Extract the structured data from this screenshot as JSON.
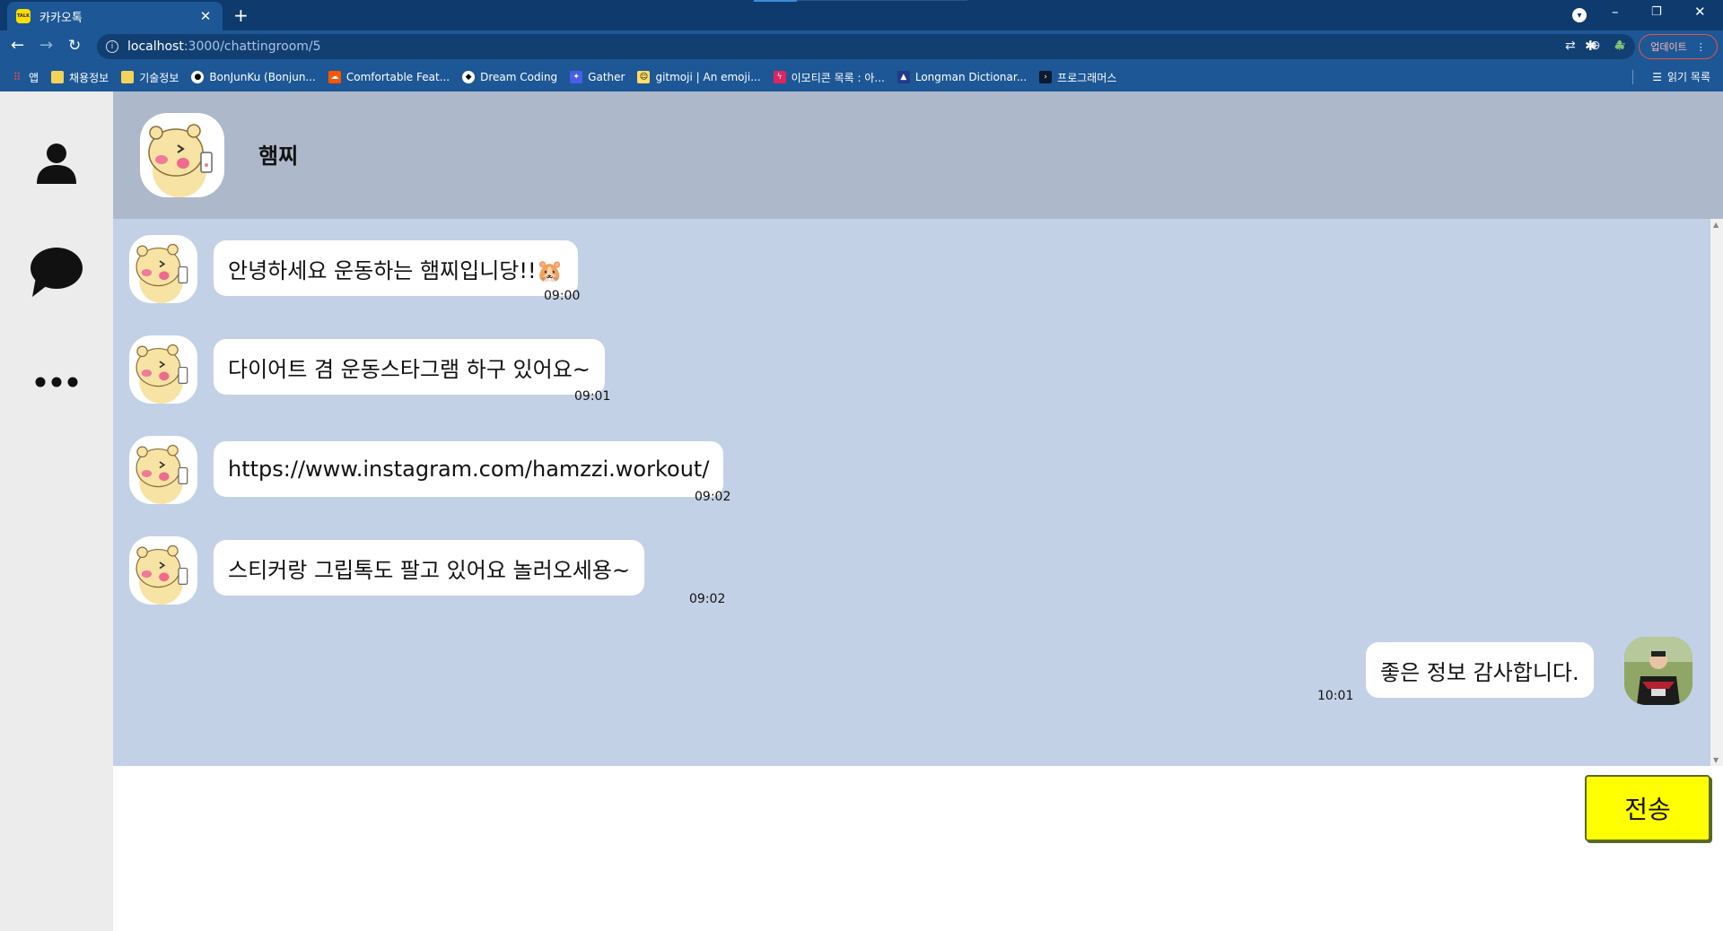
{
  "browser": {
    "tab_title": "카카오톡",
    "tab_favicon": "TALK",
    "url_host": "localhost",
    "url_path": ":3000/chattingroom/5",
    "update_label": "업데이트",
    "bookmarks": [
      {
        "label": "앱",
        "icon": "apps-grid-icon"
      },
      {
        "label": "채용정보",
        "icon": "folder-icon"
      },
      {
        "label": "기술정보",
        "icon": "folder-icon"
      },
      {
        "label": "BonJunKu (Bonjun...",
        "icon": "github-icon"
      },
      {
        "label": "Comfortable Feat...",
        "icon": "soundcloud-icon"
      },
      {
        "label": "Dream Coding",
        "icon": "dream-coding-icon"
      },
      {
        "label": "Gather",
        "icon": "gather-icon"
      },
      {
        "label": "gitmoji | An emoji...",
        "icon": "gitmoji-icon"
      },
      {
        "label": "이모티콘 목록 : 아...",
        "icon": "lightning-icon"
      },
      {
        "label": "Longman Dictionar...",
        "icon": "longman-icon"
      },
      {
        "label": "프로그래머스",
        "icon": "programmers-icon"
      }
    ],
    "reading_list": "읽기 목록"
  },
  "chat": {
    "partner_name": "햄찌",
    "messages": [
      {
        "side": "left",
        "text": "안녕하세요 운동하는 햄찌입니당!!🐹",
        "time": "09:00"
      },
      {
        "side": "left",
        "text": "다이어트 겸 운동스타그램 하구 있어요~",
        "time": "09:01"
      },
      {
        "side": "left",
        "text": "https://www.instagram.com/hamzzi.workout/",
        "time": "09:02"
      },
      {
        "side": "left",
        "text": "스티커랑 그립톡도 팔고 있어요 놀러오세용~",
        "time": "09:02"
      },
      {
        "side": "right",
        "text": "좋은 정보 감사합니다.",
        "time": "10:01"
      }
    ],
    "send_label": "전송"
  },
  "colors": {
    "header_bg": "#adb9ca",
    "chat_bg": "#c3d1e6",
    "sidebar_bg": "#ececec",
    "send_button": "#ffff00"
  }
}
